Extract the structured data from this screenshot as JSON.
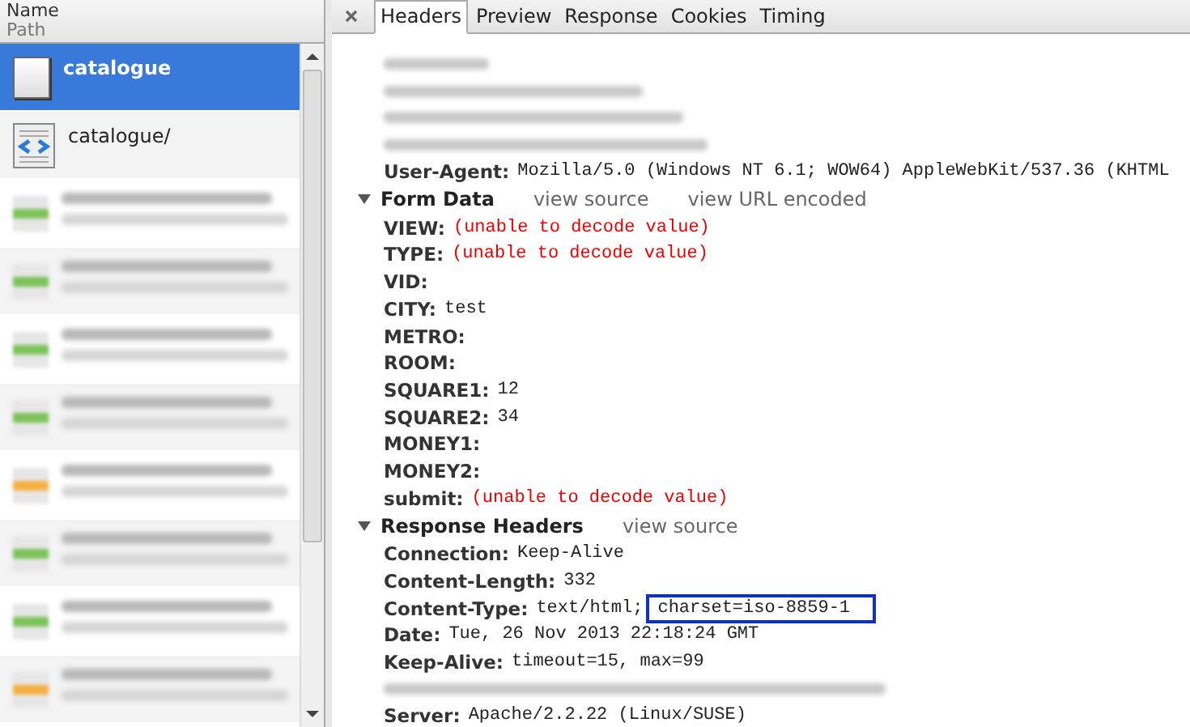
{
  "request_list": {
    "columns": [
      "Name",
      "Path"
    ],
    "requests": [
      {
        "kind": "blank",
        "name": "catalogue",
        "selected": true
      },
      {
        "kind": "html",
        "name": "catalogue/",
        "selected": false
      },
      {
        "kind": "redacted",
        "color": "#7cc35a"
      },
      {
        "kind": "redacted",
        "color": "#7cc35a"
      },
      {
        "kind": "redacted",
        "color": "#7cc35a"
      },
      {
        "kind": "redacted",
        "color": "#7cc35a"
      },
      {
        "kind": "redacted",
        "color": "#f5b042"
      },
      {
        "kind": "redacted",
        "color": "#7cc35a"
      },
      {
        "kind": "redacted",
        "color": "#7cc35a"
      },
      {
        "kind": "redacted",
        "color": "#f5b042"
      }
    ]
  },
  "detail": {
    "tabs": [
      {
        "label": "Headers",
        "selected": true
      },
      {
        "label": "Preview",
        "selected": false
      },
      {
        "label": "Response",
        "selected": false
      },
      {
        "label": "Cookies",
        "selected": false
      },
      {
        "label": "Timing",
        "selected": false
      }
    ],
    "top_rows": [
      {
        "kind": "redacted"
      },
      {
        "kind": "redacted"
      },
      {
        "kind": "redacted"
      },
      {
        "kind": "redacted"
      },
      {
        "kind": "field",
        "name": "User-Agent:",
        "value": "Mozilla/5.0 (Windows NT 6.1; WOW64) AppleWebKit/537.36 (KHTML"
      }
    ],
    "sections": [
      {
        "title": "Form Data",
        "expanded": true,
        "links": [
          "view source",
          "view URL encoded"
        ],
        "rows": [
          {
            "kind": "field",
            "name": "VIEW:",
            "value": "(unable to decode value)",
            "error": true
          },
          {
            "kind": "field",
            "name": "TYPE:",
            "value": "(unable to decode value)",
            "error": true
          },
          {
            "kind": "field",
            "name": "VID:"
          },
          {
            "kind": "field",
            "name": "CITY:",
            "value": "test",
            "error": false
          },
          {
            "kind": "field",
            "name": "METRO:"
          },
          {
            "kind": "field",
            "name": "ROOM:"
          },
          {
            "kind": "field",
            "name": "SQUARE1:",
            "value": "12",
            "error": false
          },
          {
            "kind": "field",
            "name": "SQUARE2:",
            "value": "34",
            "error": false
          },
          {
            "kind": "field",
            "name": "MONEY1:"
          },
          {
            "kind": "field",
            "name": "MONEY2:"
          },
          {
            "kind": "field",
            "name": "submit:",
            "value": "(unable to decode value)",
            "error": true
          }
        ]
      },
      {
        "title": "Response Headers",
        "expanded": true,
        "links": [
          "view source"
        ],
        "rows": [
          {
            "kind": "field",
            "name": "Connection:",
            "value": "Keep-Alive",
            "error": false
          },
          {
            "kind": "field",
            "name": "Content-Length:",
            "value": "332",
            "error": false
          },
          {
            "kind": "field",
            "name": "Content-Type:",
            "value": "text/html;",
            "highlight": "charset=iso-8859-1",
            "error": false
          },
          {
            "kind": "field",
            "name": "Date:",
            "value": "Tue, 26 Nov 2013 22:18:24 GMT",
            "error": false
          },
          {
            "kind": "field",
            "name": "Keep-Alive:",
            "value": "timeout=15, max=99",
            "error": false
          },
          {
            "kind": "redacted"
          },
          {
            "kind": "field",
            "name": "Server:",
            "value": "Apache/2.2.22 (Linux/SUSE)",
            "error": false
          }
        ]
      }
    ]
  }
}
